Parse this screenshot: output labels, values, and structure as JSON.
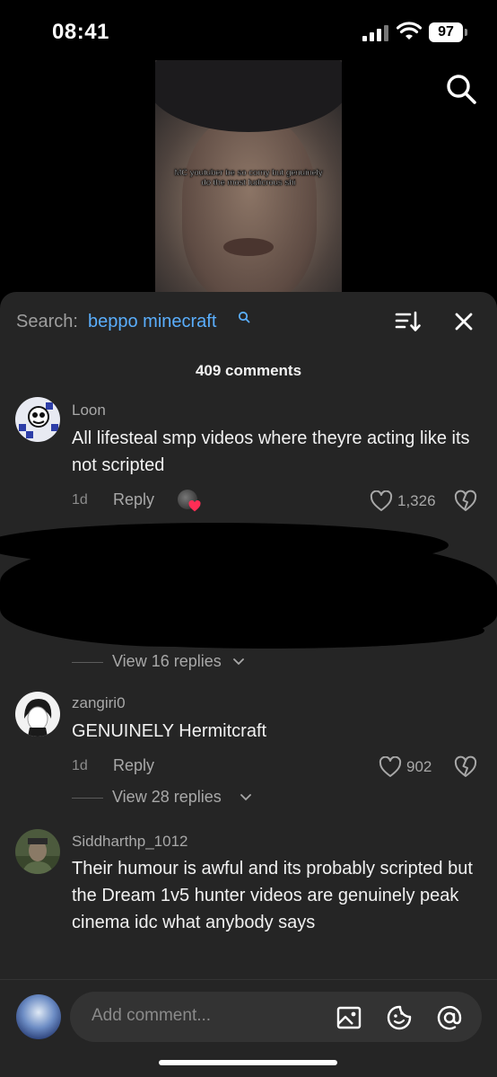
{
  "status_bar": {
    "time": "08:41",
    "battery": "97"
  },
  "video": {
    "caption": "MC youtuber be so corny but genuinely do the most ludicrous shi"
  },
  "sheet": {
    "search_label": "Search:",
    "search_query": "beppo minecraft",
    "comment_count": "409 comments",
    "accent_color": "#5aaefc"
  },
  "comments": [
    {
      "username": "Loon",
      "text": "All lifesteal smp videos where theyre acting like its not scripted",
      "date": "1d",
      "reply_label": "Reply",
      "likes": "1,326",
      "view_replies": "View 16 replies"
    },
    {
      "username": "zangiri0",
      "text": "GENUINELY Hermitcraft",
      "date": "1d",
      "reply_label": "Reply",
      "likes": "902",
      "view_replies": "View 28 replies"
    },
    {
      "username": "Siddharthp_1012",
      "text": "Their humour is awful and its probably scripted but the Dream 1v5 hunter videos are genuinely peak cinema idc what anybody says"
    }
  ],
  "input": {
    "placeholder": "Add comment..."
  }
}
